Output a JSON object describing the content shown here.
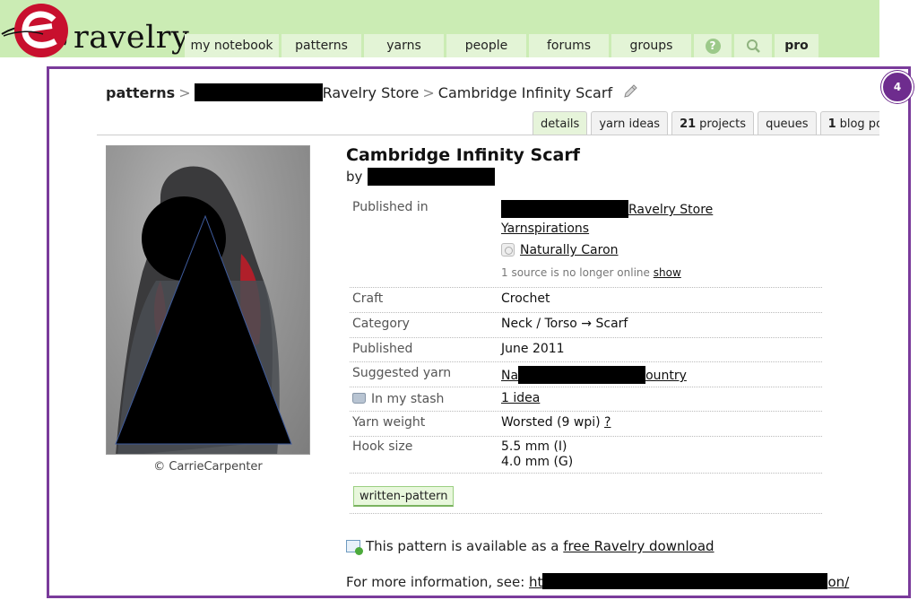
{
  "header": {
    "logo_text": "ravelry",
    "nav": [
      {
        "label": "my notebook",
        "name": "nav-my-notebook",
        "w": 108
      },
      {
        "label": "patterns",
        "name": "nav-patterns",
        "w": 92
      },
      {
        "label": "yarns",
        "name": "nav-yarns",
        "w": 92
      },
      {
        "label": "people",
        "name": "nav-people",
        "w": 92
      },
      {
        "label": "forums",
        "name": "nav-forums",
        "w": 92
      },
      {
        "label": "groups",
        "name": "nav-groups",
        "w": 92
      },
      {
        "label": "?",
        "name": "nav-help",
        "w": 45
      },
      {
        "label": "",
        "name": "nav-search",
        "w": 45
      },
      {
        "label": "pro",
        "name": "nav-pro",
        "w": 52
      }
    ]
  },
  "annotation_badge": "4",
  "breadcrumb": {
    "root": "patterns",
    "store": "Ravelry Store",
    "current": "Cambridge Infinity Scarf"
  },
  "tabs": [
    {
      "bold": "",
      "label": "details",
      "active": true
    },
    {
      "bold": "",
      "label": "yarn ideas",
      "active": false
    },
    {
      "bold": "21",
      "label": "projects",
      "active": false
    },
    {
      "bold": "",
      "label": "queues",
      "active": false
    },
    {
      "bold": "1",
      "label": "blog po",
      "active": false
    }
  ],
  "photo_credit": "© CarrieCarpenter",
  "pattern": {
    "title": "Cambridge Infinity Scarf",
    "by_label": "by"
  },
  "details": {
    "published_in_label": "Published in",
    "published_in_store": "Ravelry Store",
    "published_in_yarnspirations": "Yarnspirations",
    "published_in_caron": "Naturally Caron",
    "source_offline": "1 source is no longer online",
    "source_show": "show",
    "craft_label": "Craft",
    "craft": "Crochet",
    "category_label": "Category",
    "category": "Neck / Torso → Scarf",
    "published_label": "Published",
    "published": "June 2011",
    "suggested_yarn_label": "Suggested yarn",
    "suggested_yarn_start": "Na",
    "suggested_yarn_end": "ountry",
    "stash_label": "In my stash",
    "stash_value": "1 idea",
    "yarn_weight_label": "Yarn weight",
    "yarn_weight": "Worsted (9 wpi)",
    "yarn_weight_help": "?",
    "hook_size_label": "Hook size",
    "hook_size_1": "5.5 mm (I)",
    "hook_size_2": "4.0 mm (G)"
  },
  "tag": "written-pattern",
  "download": {
    "prefix": "This pattern is available as a",
    "link": "free Ravelry download"
  },
  "more_info": {
    "prefix": "For more information, see:",
    "link_start": "ht",
    "link_end": "on/"
  }
}
